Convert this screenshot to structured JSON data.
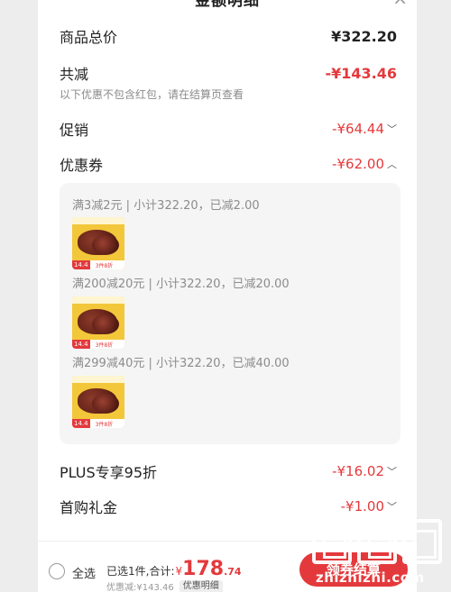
{
  "header": {
    "title": "金额明细",
    "close_icon": "×"
  },
  "rows": {
    "total": {
      "label": "商品总价",
      "value": "¥322.20"
    },
    "reduced": {
      "label": "共减",
      "value": "-¥143.46",
      "note": "以下优惠不包含红包，请在结算页查看"
    },
    "promo": {
      "label": "促销",
      "value": "-¥64.44"
    },
    "coupon": {
      "label": "优惠券",
      "value": "-¥62.00"
    },
    "plus": {
      "label": "PLUS专享95折",
      "value": "-¥16.02"
    },
    "first": {
      "label": "首购礼金",
      "value": "-¥1.00"
    }
  },
  "coupon_details": [
    {
      "text": "满3减2元 | 小计322.20，已减2.00"
    },
    {
      "text": "满200减20元 | 小计322.20，已减20.00"
    },
    {
      "text": "满299减40元 | 小计322.20，已减40.00"
    }
  ],
  "product": {
    "price_tag": "14.4",
    "promo_tag": "3件8折"
  },
  "bottom": {
    "select_all": "全选",
    "selected_prefix": "已选1件,合计:",
    "currency": "¥",
    "amount_int": "178",
    "amount_dec": ".74",
    "discount_text": "优惠减:¥143.46",
    "detail_chip": "优惠明细",
    "checkout": "领券结算"
  },
  "watermark": {
    "text": "zhizhizhi.com"
  },
  "colors": {
    "accent": "#e4393c",
    "muted": "#8c8c8c"
  }
}
